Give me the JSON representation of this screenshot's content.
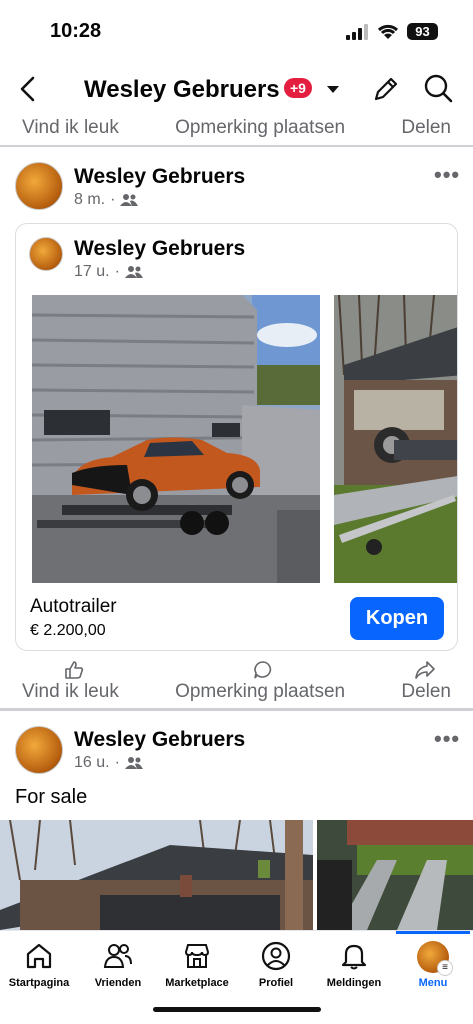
{
  "status_bar": {
    "time": "10:28",
    "battery": "93"
  },
  "header": {
    "title": "Wesley Gebruers",
    "badge": "+9"
  },
  "actions": {
    "like": "Vind ik leuk",
    "comment": "Opmerking plaatsen",
    "share": "Delen"
  },
  "post1": {
    "author": "Wesley Gebruers",
    "time": "8 m.",
    "shared": {
      "author": "Wesley Gebruers",
      "time": "17 u.",
      "listing_title": "Autotrailer",
      "price": "€ 2.200,00",
      "buy_label": "Kopen"
    }
  },
  "post2": {
    "author": "Wesley Gebruers",
    "time": "16 u.",
    "text": "For sale"
  },
  "nav": {
    "home": "Startpagina",
    "friends": "Vrienden",
    "marketplace": "Marketplace",
    "profile": "Profiel",
    "notifications": "Meldingen",
    "menu": "Menu"
  },
  "colors": {
    "accent": "#0866ff",
    "badge": "#e41e3f",
    "muted": "#65676b"
  }
}
